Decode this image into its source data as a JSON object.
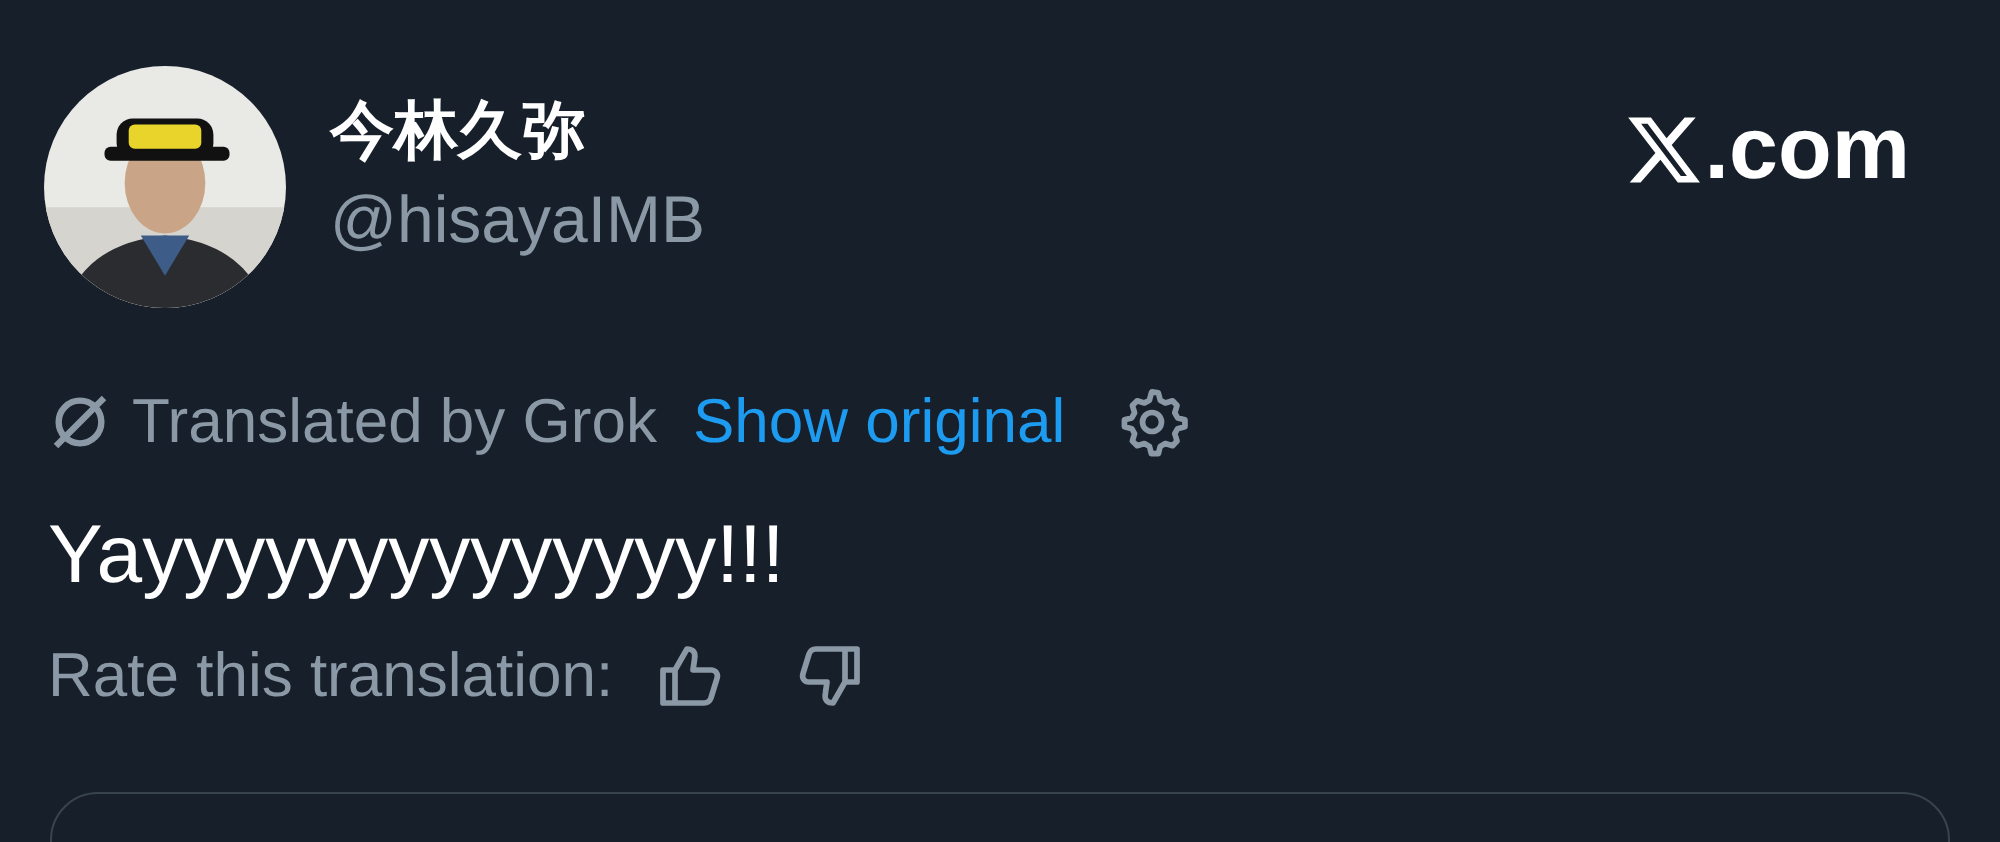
{
  "author": {
    "name": "今林久弥",
    "handle": "@hisayaIMB"
  },
  "brand": {
    "suffix": ".com"
  },
  "translation": {
    "label": "Translated by Grok",
    "link": "Show original"
  },
  "post": {
    "text": "Yayyyyyyyyyyyyyy!!!"
  },
  "rating": {
    "label": "Rate this translation:"
  }
}
